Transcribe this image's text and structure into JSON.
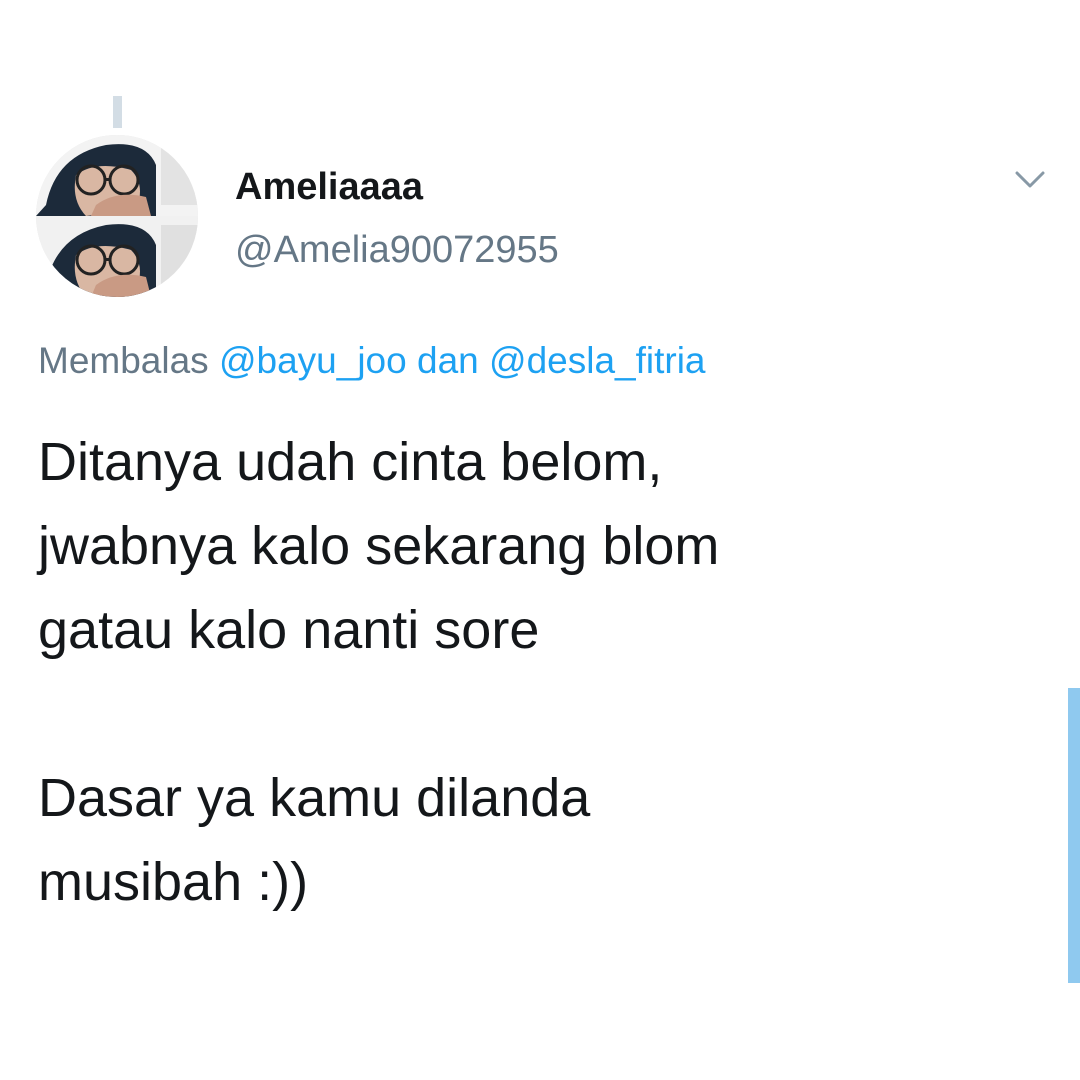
{
  "tweet": {
    "author": {
      "display_name": "Ameliaaaa",
      "handle": "@Amelia90072955",
      "avatar_icon": "profile-photo"
    },
    "menu_icon": "chevron-down-icon",
    "reply_context": {
      "prefix": "Membalas",
      "mention_1": "@bayu_joo",
      "conjunction": "dan",
      "mention_2": "@desla_fitria"
    },
    "text_paragraphs": [
      [
        "Ditanya udah cinta belom,",
        "jwabnya kalo sekarang blom",
        "gatau kalo nanti sore"
      ],
      [
        "Dasar ya kamu dilanda",
        "musibah :))"
      ]
    ]
  },
  "colors": {
    "text": "#14171a",
    "secondary": "#657786",
    "link": "#1da1f2",
    "scrollbar": "#8fc9ef"
  }
}
